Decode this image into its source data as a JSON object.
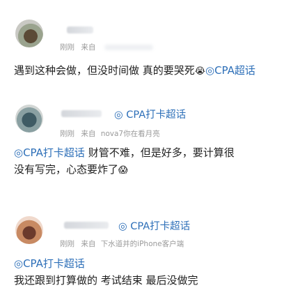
{
  "post1": {
    "meta_time": "刚刚",
    "meta_from": "来自",
    "text_main": "遇到这种会做，但没时间做 真的要哭死",
    "text_emoji": "😭",
    "text_tag": "◎CPA超话"
  },
  "post2": {
    "tag_header": "◎ CPA打卡超话",
    "meta_time": "刚刚",
    "meta_from": "来自",
    "meta_device": "nova7你在看月亮",
    "text_line1_tag": "◎CPA打卡超话",
    "text_line1_rest": " 财管不难，但是好多，要计算很",
    "text_line2": "没有写完，心态要炸了",
    "text_emoji": "😱"
  },
  "post3": {
    "tag_header": "◎ CPA打卡超话",
    "meta_time": "刚刚",
    "meta_from": "来自",
    "meta_device": "下水道并的iPhone客户端",
    "text_tag": "◎CPA打卡超话",
    "text_line": "我还跟到打算做的 考试结束 最后没做完"
  },
  "colors": {
    "link": "#2d6fb8",
    "meta": "#9a9a9a",
    "text": "#1e1e1e"
  }
}
